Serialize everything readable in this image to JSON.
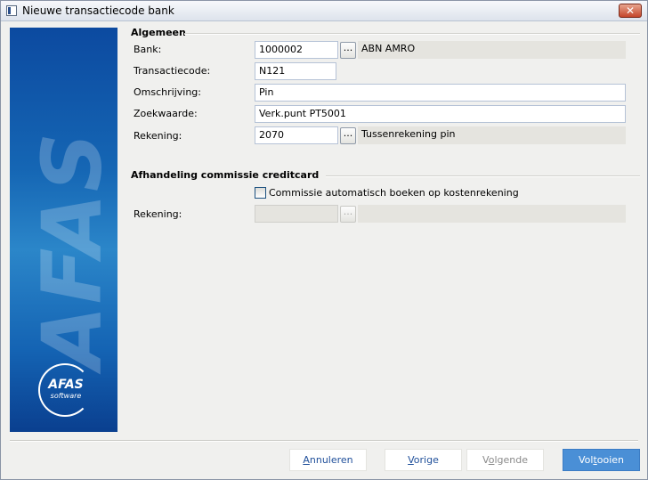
{
  "window": {
    "title": "Nieuwe transactiecode bank",
    "close_glyph": "✕"
  },
  "banner": {
    "watermark": "AFAS",
    "logo_text": "AFAS",
    "logo_sub": "software"
  },
  "algemeen": {
    "title": "Algemeen",
    "bank_label": "Bank:",
    "bank_value": "1000002",
    "bank_name": "ABN AMRO",
    "transactiecode_label": "Transactiecode:",
    "transactiecode_value": "N121",
    "omschrijving_label": "Omschrijving:",
    "omschrijving_value": "Pin",
    "zoekwaarde_label": "Zoekwaarde:",
    "zoekwaarde_value": "Verk.punt PT5001",
    "rekening_label": "Rekening:",
    "rekening_value": "2070",
    "rekening_name": "Tussenrekening pin",
    "browse_glyph": "..."
  },
  "afhandeling": {
    "title": "Afhandeling commissie creditcard",
    "checkbox_label": "Commissie automatisch boeken op kostenrekening",
    "checkbox_checked": false,
    "rekening_label": "Rekening:",
    "rekening_value": "",
    "rekening_name": "",
    "browse_glyph": "..."
  },
  "footer": {
    "annuleren_u": "A",
    "annuleren_rest": "nnuleren",
    "vorige_u": "V",
    "vorige_rest": "orige",
    "volgende_pre": "V",
    "volgende_u": "o",
    "volgende_rest": "lgende",
    "voltooien_pre": "Vol",
    "voltooien_u": "t",
    "voltooien_rest": "ooien"
  }
}
